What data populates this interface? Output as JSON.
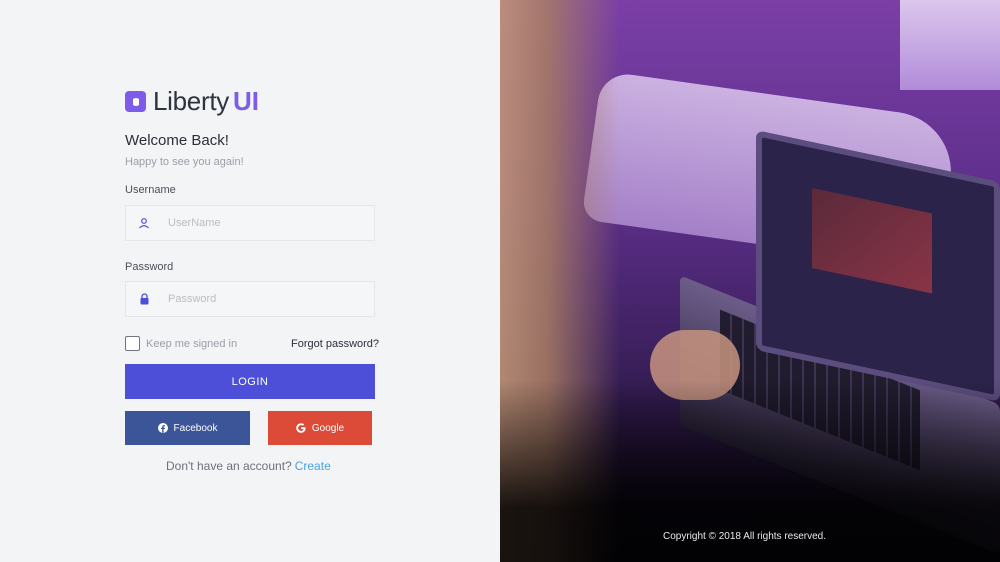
{
  "brand": {
    "name": "Liberty",
    "accent": "UI",
    "color": "#7c5ce8"
  },
  "form": {
    "title": "Welcome Back!",
    "subtitle": "Happy to see you again!",
    "username_label": "Username",
    "username_placeholder": "UserName",
    "password_label": "Password",
    "password_placeholder": "Password",
    "remember_label": "Keep me signed in",
    "forgot_label": "Forgot password?",
    "login_label": "LOGIN",
    "facebook_label": "Facebook",
    "google_label": "Google",
    "signup_prompt": "Don't have an account?",
    "signup_link": "Create"
  },
  "colors": {
    "primary": "#4d4fd8",
    "facebook": "#3b5598",
    "google": "#dc4a38",
    "link": "#4aa3df",
    "icon": "#4d4fd8"
  },
  "icons": {
    "username": "user-icon",
    "password": "lock-icon",
    "facebook": "facebook-icon",
    "google": "google-icon"
  },
  "footer": {
    "copyright": "Copyright © 2018 All rights reserved."
  }
}
